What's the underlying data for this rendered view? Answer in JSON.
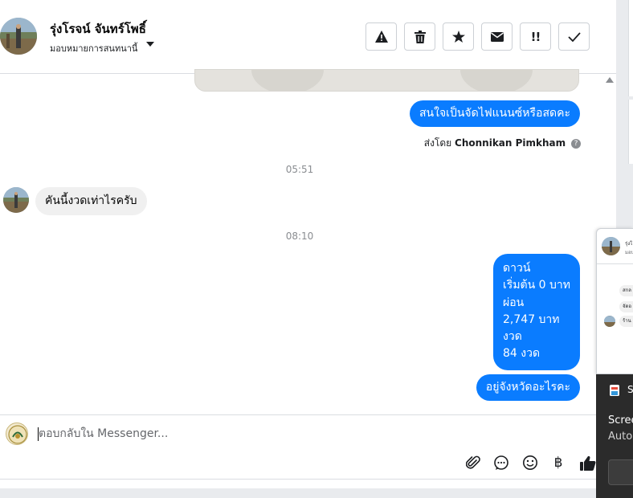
{
  "header": {
    "contact_name": "รุ่งโรจน์ จันทร์โพธิ์",
    "subtitle": "มอบหมายการสนทนานี้",
    "actions": [
      {
        "name": "report-icon",
        "glyph": "!"
      },
      {
        "name": "trash-icon",
        "glyph": "🗑"
      },
      {
        "name": "star-icon",
        "glyph": "★"
      },
      {
        "name": "envelope-icon",
        "glyph": "✉"
      },
      {
        "name": "follow-up-icon",
        "glyph": "!!"
      },
      {
        "name": "checkmark-icon",
        "glyph": "✓"
      }
    ]
  },
  "messages": {
    "outgoing_1": "สนใจเป็นจัดไฟแนนซ์หรือสดคะ",
    "sent_by_prefix": "ส่งโดย",
    "sent_by_name": "Chonnikan Pimkham",
    "time_1": "05:51",
    "incoming_1": "คันนี้งวดเท่าไรครับ",
    "time_2": "08:10",
    "outgoing_2_lines": [
      "ดาวน์",
      "เริ่มต้น 0 บาท",
      "ผ่อน",
      "2,747 บาท",
      "งวด",
      "84 งวด"
    ],
    "outgoing_3": "อยู่จังหวัดอะไรคะ"
  },
  "composer": {
    "placeholder": "ตอบกลับใน Messenger...",
    "icons": [
      "attachment-icon",
      "saved-replies-icon",
      "emoji-icon",
      "baht-payment-icon",
      "like-icon"
    ],
    "baht_glyph": "฿"
  },
  "mini_chat": {
    "name": "รุ่งโ",
    "subtitle": "มอบ",
    "bubbles": [
      "สกล",
      "จัดอ",
      "ร้าน"
    ]
  },
  "notification": {
    "title": "S",
    "line1": "Scree",
    "line2": "Auto"
  },
  "colors": {
    "accent": "#0a7cff",
    "incoming_bubble": "#f0f0f0",
    "muted_text": "#8a8d91",
    "toast_bg": "#2b2b2b"
  }
}
